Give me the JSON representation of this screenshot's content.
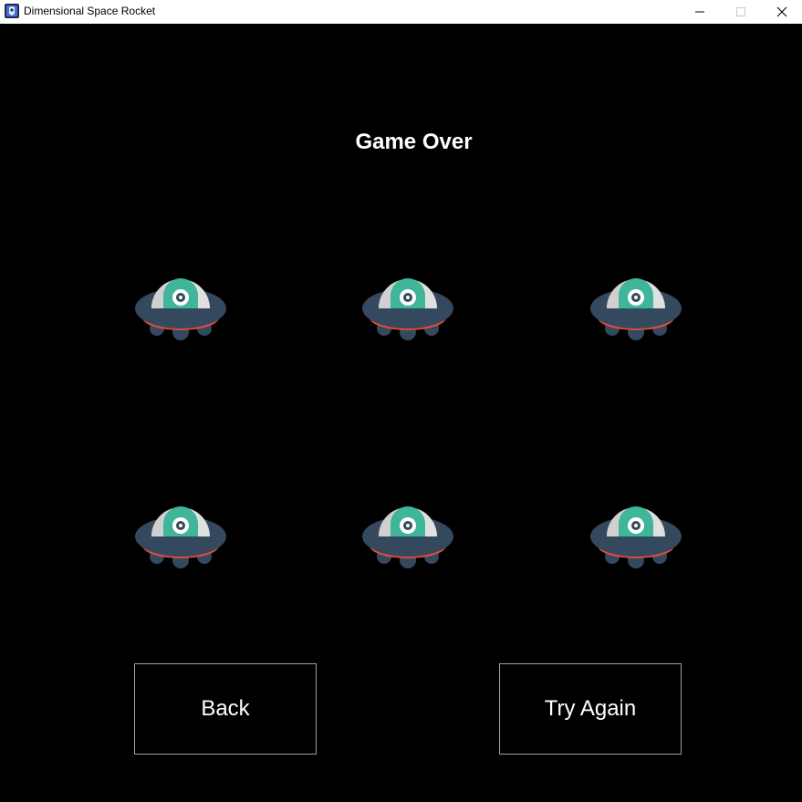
{
  "window": {
    "title": "Dimensional Space Rocket",
    "icon": "game-app-icon",
    "controls": [
      "minimize-icon",
      "maximize-icon",
      "close-icon"
    ]
  },
  "game": {
    "heading": "Game Over",
    "enemies": [
      {
        "icon": "ufo-icon",
        "row": 1,
        "col": 1
      },
      {
        "icon": "ufo-icon",
        "row": 1,
        "col": 2
      },
      {
        "icon": "ufo-icon",
        "row": 1,
        "col": 3
      },
      {
        "icon": "ufo-icon",
        "row": 2,
        "col": 1
      },
      {
        "icon": "ufo-icon",
        "row": 2,
        "col": 2
      },
      {
        "icon": "ufo-icon",
        "row": 2,
        "col": 3
      }
    ],
    "buttons": {
      "back": "Back",
      "try_again": "Try Again"
    }
  },
  "colors": {
    "background": "#000000",
    "ufo_body": "#34495e",
    "ufo_dome": "#e0e0e0",
    "ufo_alien": "#3fb59a",
    "ufo_band": "#e04b3f"
  }
}
